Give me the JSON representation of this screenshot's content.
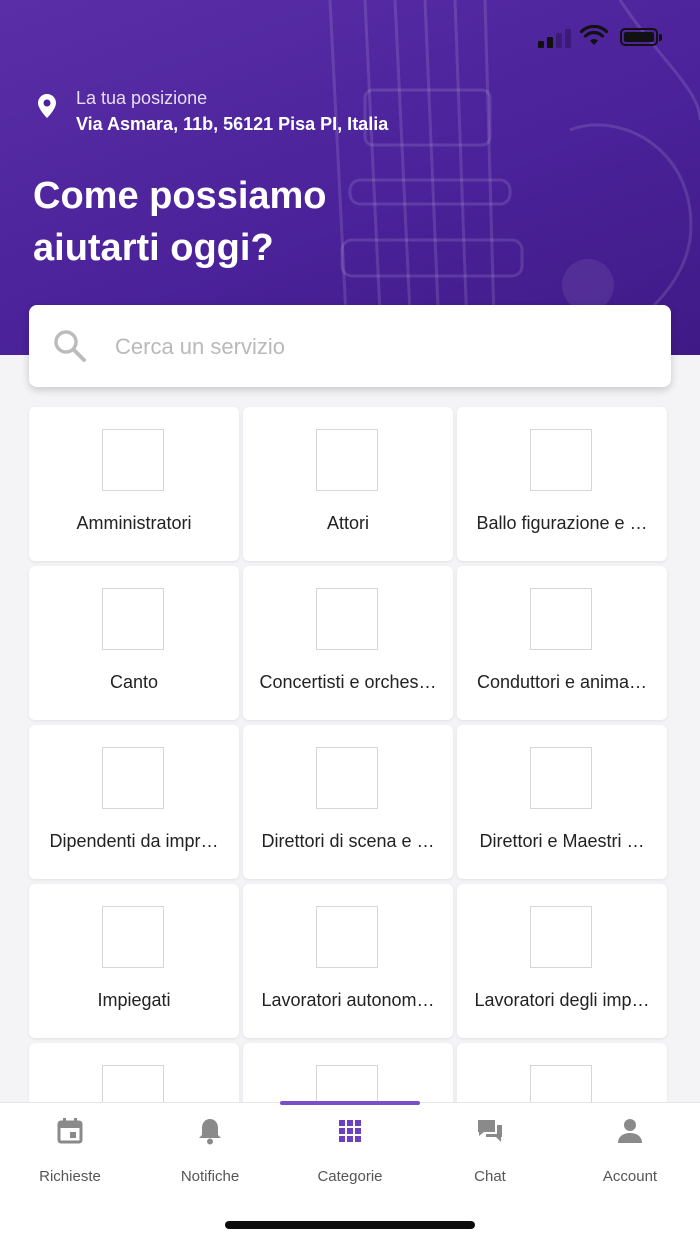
{
  "location": {
    "label": "La tua posizione",
    "address": "Via Asmara, 11b, 56121 Pisa PI, Italia"
  },
  "hero": {
    "title_line1": "Come possiamo",
    "title_line2": "aiutarti oggi?"
  },
  "search": {
    "placeholder": "Cerca un servizio",
    "value": ""
  },
  "categories": [
    {
      "label": "Amministratori"
    },
    {
      "label": "Attori"
    },
    {
      "label": "Ballo figurazione e …"
    },
    {
      "label": "Canto"
    },
    {
      "label": "Concertisti e orches…"
    },
    {
      "label": "Conduttori e anima…"
    },
    {
      "label": "Dipendenti da impr…"
    },
    {
      "label": "Direttori di scena e …"
    },
    {
      "label": "Direttori e Maestri …"
    },
    {
      "label": "Impiegati"
    },
    {
      "label": "Lavoratori autonom…"
    },
    {
      "label": "Lavoratori degli imp…"
    },
    {
      "label": ""
    },
    {
      "label": ""
    },
    {
      "label": ""
    }
  ],
  "tabs": [
    {
      "label": "Richieste",
      "icon": "calendar-icon"
    },
    {
      "label": "Notifiche",
      "icon": "bell-icon"
    },
    {
      "label": "Categorie",
      "icon": "grid-icon",
      "active": true
    },
    {
      "label": "Chat",
      "icon": "chat-icon"
    },
    {
      "label": "Account",
      "icon": "person-icon"
    }
  ],
  "colors": {
    "accent": "#5b30a8",
    "tab_active": "#6a3fc0",
    "tab_inactive": "#8a8a8a"
  }
}
